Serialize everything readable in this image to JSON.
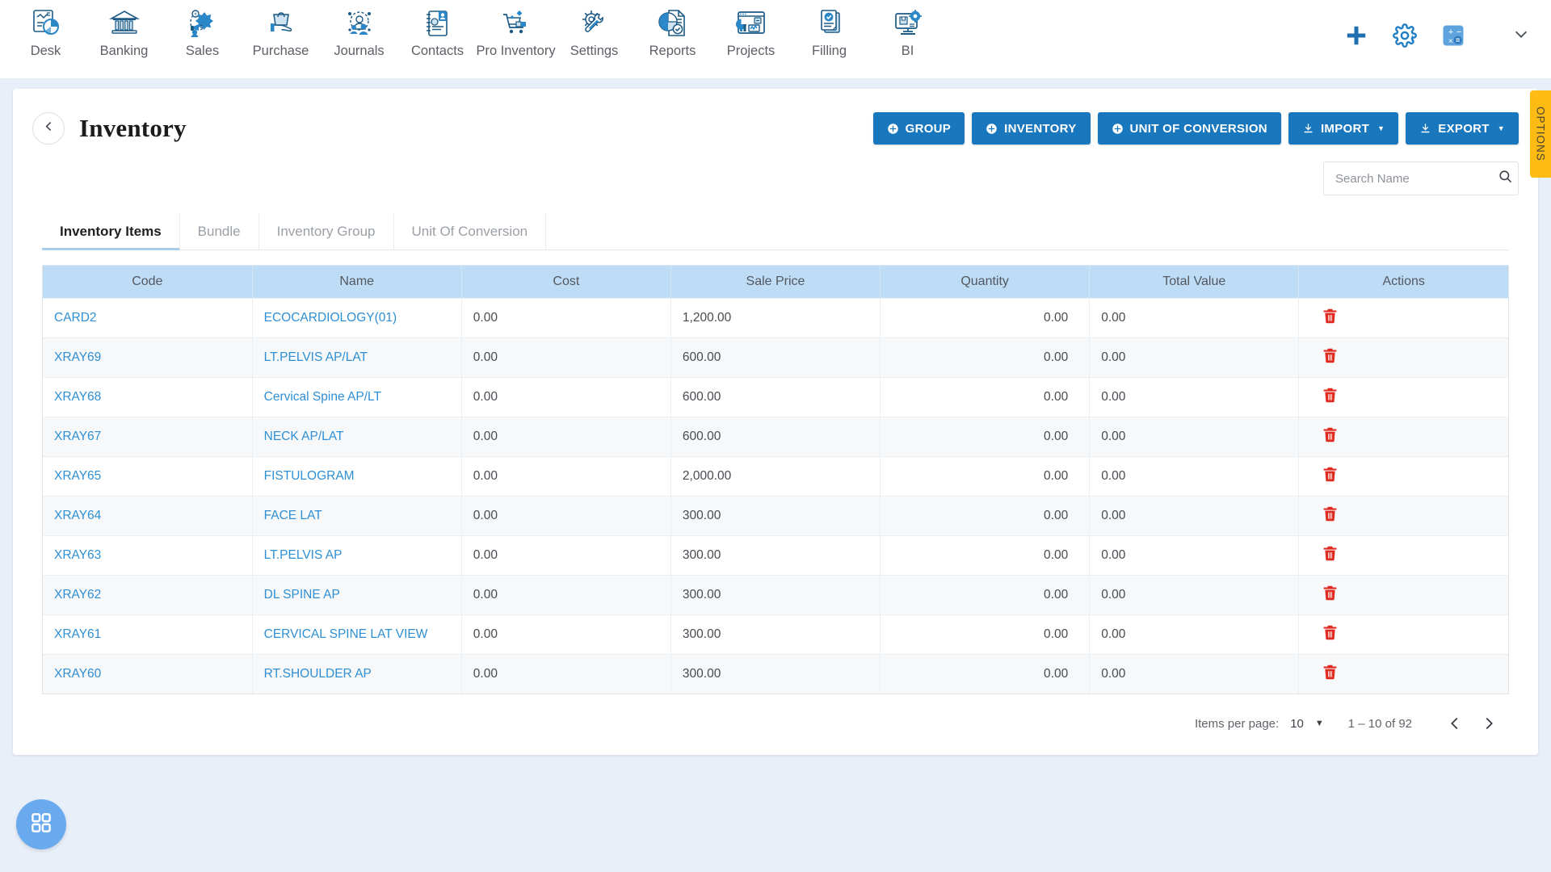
{
  "topnav": {
    "items": [
      {
        "label": "Desk",
        "icon": "desk-analytics-icon"
      },
      {
        "label": "Banking",
        "icon": "bank-building-icon"
      },
      {
        "label": "Sales",
        "icon": "sales-megaphone-icon"
      },
      {
        "label": "Purchase",
        "icon": "purchase-hand-bag-icon"
      },
      {
        "label": "Journals",
        "icon": "journals-gear-people-icon"
      },
      {
        "label": "Contacts",
        "icon": "contacts-address-book-icon"
      },
      {
        "label": "Pro Inventory",
        "icon": "pro-inventory-cart-icon"
      },
      {
        "label": "Settings",
        "icon": "settings-gear-wrench-icon"
      },
      {
        "label": "Reports",
        "icon": "reports-pie-doc-icon"
      },
      {
        "label": "Projects",
        "icon": "projects-dashboard-icon"
      },
      {
        "label": "Filling",
        "icon": "filling-documents-check-icon"
      },
      {
        "label": "BI",
        "icon": "bi-monitor-gear-icon"
      }
    ],
    "actions": [
      {
        "name": "add-icon",
        "title": "Add"
      },
      {
        "name": "gear-icon",
        "title": "Settings"
      },
      {
        "name": "calculator-icon",
        "title": "Calculator"
      }
    ],
    "expand": {
      "name": "chevron-down-icon"
    }
  },
  "header": {
    "back_icon": "chevron-left-icon",
    "title": "Inventory",
    "buttons": [
      {
        "label": "GROUP",
        "icon": "plus-circle-icon",
        "dropdown": false
      },
      {
        "label": "INVENTORY",
        "icon": "plus-circle-icon",
        "dropdown": false
      },
      {
        "label": "UNIT OF CONVERSION",
        "icon": "plus-circle-icon",
        "dropdown": false
      },
      {
        "label": "IMPORT",
        "icon": "download-icon",
        "dropdown": true
      },
      {
        "label": "EXPORT",
        "icon": "download-icon",
        "dropdown": true
      }
    ],
    "primary_color": "#1877bd"
  },
  "options_tab": {
    "label": "OPTIONS",
    "color": "#fdbb13"
  },
  "search": {
    "placeholder": "Search Name",
    "value": "",
    "icon": "search-icon"
  },
  "tabs": [
    {
      "label": "Inventory Items",
      "active": true
    },
    {
      "label": "Bundle",
      "active": false
    },
    {
      "label": "Inventory Group",
      "active": false
    },
    {
      "label": "Unit Of Conversion",
      "active": false
    }
  ],
  "table": {
    "columns": [
      "Code",
      "Name",
      "Cost",
      "Sale Price",
      "Quantity",
      "Total Value",
      "Actions"
    ],
    "header_bg": "#bfdcf7",
    "link_color": "#2e8fd4",
    "delete_icon": "trash-icon",
    "delete_color": "#e02b20",
    "rows": [
      {
        "code": "CARD2",
        "name": "ECOCARDIOLOGY(01)",
        "cost": "0.00",
        "sale_price": "1,200.00",
        "quantity": "0.00",
        "total_value": "0.00"
      },
      {
        "code": "XRAY69",
        "name": "LT.PELVIS AP/LAT",
        "cost": "0.00",
        "sale_price": "600.00",
        "quantity": "0.00",
        "total_value": "0.00"
      },
      {
        "code": "XRAY68",
        "name": "Cervical Spine AP/LT",
        "cost": "0.00",
        "sale_price": "600.00",
        "quantity": "0.00",
        "total_value": "0.00"
      },
      {
        "code": "XRAY67",
        "name": "NECK AP/LAT",
        "cost": "0.00",
        "sale_price": "600.00",
        "quantity": "0.00",
        "total_value": "0.00"
      },
      {
        "code": "XRAY65",
        "name": "FISTULOGRAM",
        "cost": "0.00",
        "sale_price": "2,000.00",
        "quantity": "0.00",
        "total_value": "0.00"
      },
      {
        "code": "XRAY64",
        "name": "FACE LAT",
        "cost": "0.00",
        "sale_price": "300.00",
        "quantity": "0.00",
        "total_value": "0.00"
      },
      {
        "code": "XRAY63",
        "name": "LT.PELVIS AP",
        "cost": "0.00",
        "sale_price": "300.00",
        "quantity": "0.00",
        "total_value": "0.00"
      },
      {
        "code": "XRAY62",
        "name": "DL SPINE AP",
        "cost": "0.00",
        "sale_price": "300.00",
        "quantity": "0.00",
        "total_value": "0.00"
      },
      {
        "code": "XRAY61",
        "name": "CERVICAL SPINE LAT VIEW",
        "cost": "0.00",
        "sale_price": "300.00",
        "quantity": "0.00",
        "total_value": "0.00"
      },
      {
        "code": "XRAY60",
        "name": "RT.SHOULDER AP",
        "cost": "0.00",
        "sale_price": "300.00",
        "quantity": "0.00",
        "total_value": "0.00"
      }
    ]
  },
  "paginator": {
    "items_per_page_label": "Items per page:",
    "items_per_page_value": "10",
    "range_label": "1 – 10 of 92",
    "prev_icon": "chevron-left-icon",
    "next_icon": "chevron-right-icon"
  },
  "fab": {
    "icon": "grid-apps-icon",
    "color": "#69aaef"
  }
}
